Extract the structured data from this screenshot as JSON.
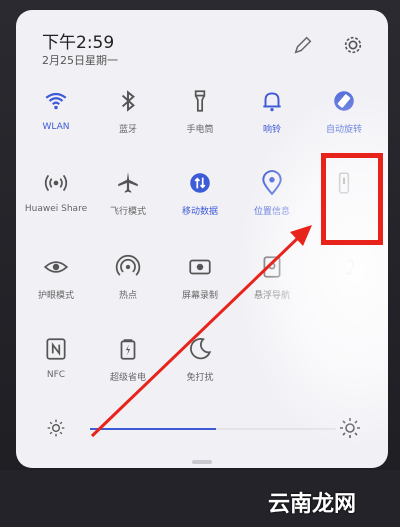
{
  "status": {
    "time": "下午2:59",
    "date": "2月25日星期一"
  },
  "tiles": [
    {
      "label": "WLAN",
      "icon": "wifi-icon",
      "active": true
    },
    {
      "label": "蓝牙",
      "icon": "bluetooth-icon",
      "active": false
    },
    {
      "label": "手电筒",
      "icon": "flashlight-icon",
      "active": false
    },
    {
      "label": "响铃",
      "icon": "bell-icon",
      "active": true
    },
    {
      "label": "自动旋转",
      "icon": "rotate-icon",
      "active": true
    },
    {
      "label": "Huawei Share",
      "icon": "share-icon",
      "active": false
    },
    {
      "label": "飞行模式",
      "icon": "airplane-icon",
      "active": false
    },
    {
      "label": "移动数据",
      "icon": "mobile-data-icon",
      "active": true
    },
    {
      "label": "位置信息",
      "icon": "location-icon",
      "active": true
    },
    {
      "label": "",
      "icon": "portrait-icon",
      "active": false
    },
    {
      "label": "护眼模式",
      "icon": "eye-icon",
      "active": false
    },
    {
      "label": "热点",
      "icon": "hotspot-icon",
      "active": false
    },
    {
      "label": "屏幕录制",
      "icon": "screen-record-icon",
      "active": false
    },
    {
      "label": "悬浮导航",
      "icon": "float-nav-icon",
      "active": false
    },
    {
      "label": "",
      "icon": "screenshot-icon",
      "active": false
    },
    {
      "label": "NFC",
      "icon": "nfc-icon",
      "active": false
    },
    {
      "label": "超级省电",
      "icon": "battery-saver-icon",
      "active": false
    },
    {
      "label": "免打扰",
      "icon": "moon-icon",
      "active": false
    }
  ],
  "brightness": {
    "level": 0.5
  },
  "watermark": "云南龙网"
}
